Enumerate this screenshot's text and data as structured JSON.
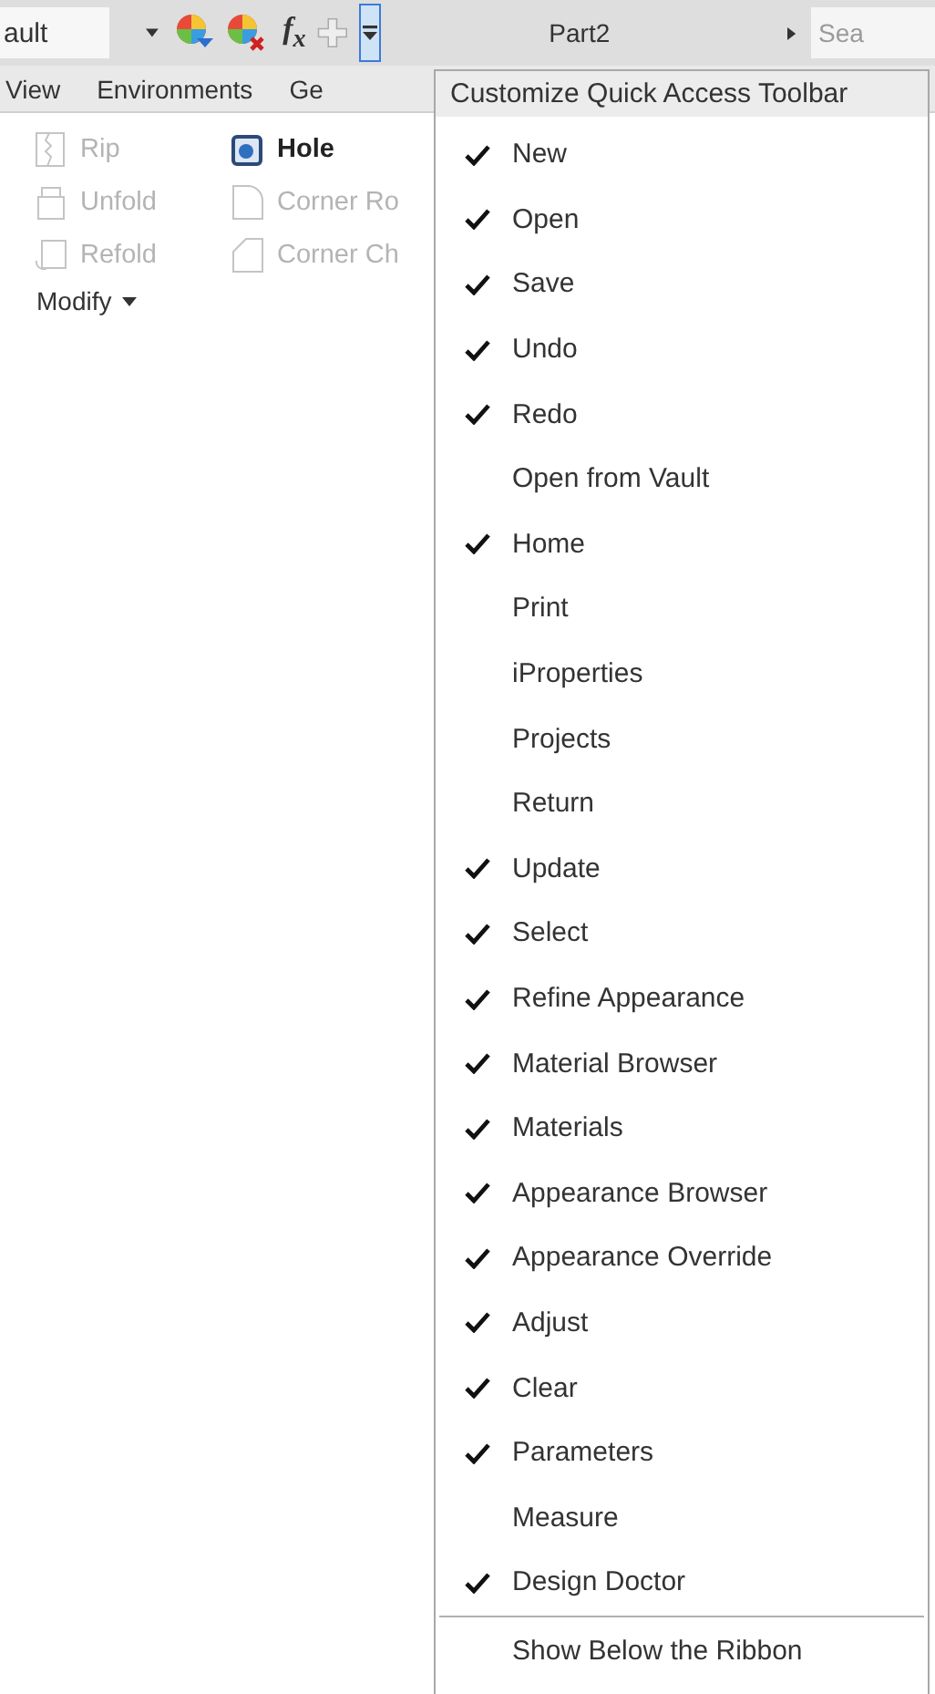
{
  "quick_access": {
    "style_field": "ault",
    "formula_button": "f$_{x}$",
    "document_title": "Part2",
    "search": {
      "placeholder": "Sea"
    }
  },
  "ribbon_tabs": [
    "View",
    "Environments",
    "Ge"
  ],
  "ribbon_tools": [
    {
      "label": "Rip",
      "disabled": true,
      "kind": "rip"
    },
    {
      "label": "Hole",
      "disabled": false,
      "kind": "hole"
    },
    {
      "label": "Unfold",
      "disabled": true,
      "kind": "unfold"
    },
    {
      "label": "Corner Ro",
      "disabled": true,
      "kind": "round"
    },
    {
      "label": "Refold",
      "disabled": true,
      "kind": "refold"
    },
    {
      "label": "Corner Ch",
      "disabled": true,
      "kind": "chamfer"
    }
  ],
  "panel_title": "Modify",
  "menu": {
    "title": "Customize Quick Access Toolbar",
    "items": [
      {
        "label": "New",
        "checked": true
      },
      {
        "label": "Open",
        "checked": true
      },
      {
        "label": "Save",
        "checked": true
      },
      {
        "label": "Undo",
        "checked": true
      },
      {
        "label": "Redo",
        "checked": true
      },
      {
        "label": "Open from Vault",
        "checked": false
      },
      {
        "label": "Home",
        "checked": true
      },
      {
        "label": "Print",
        "checked": false
      },
      {
        "label": "iProperties",
        "checked": false
      },
      {
        "label": "Projects",
        "checked": false
      },
      {
        "label": "Return",
        "checked": false
      },
      {
        "label": "Update",
        "checked": true
      },
      {
        "label": "Select",
        "checked": true
      },
      {
        "label": "Refine Appearance",
        "checked": true
      },
      {
        "label": "Material Browser",
        "checked": true
      },
      {
        "label": "Materials",
        "checked": true
      },
      {
        "label": "Appearance Browser",
        "checked": true
      },
      {
        "label": "Appearance Override",
        "checked": true
      },
      {
        "label": "Adjust",
        "checked": true
      },
      {
        "label": "Clear",
        "checked": true
      },
      {
        "label": "Parameters",
        "checked": true
      },
      {
        "label": "Measure",
        "checked": false
      },
      {
        "label": "Design Doctor",
        "checked": true
      }
    ],
    "footer_item": "Show Below the Ribbon"
  }
}
